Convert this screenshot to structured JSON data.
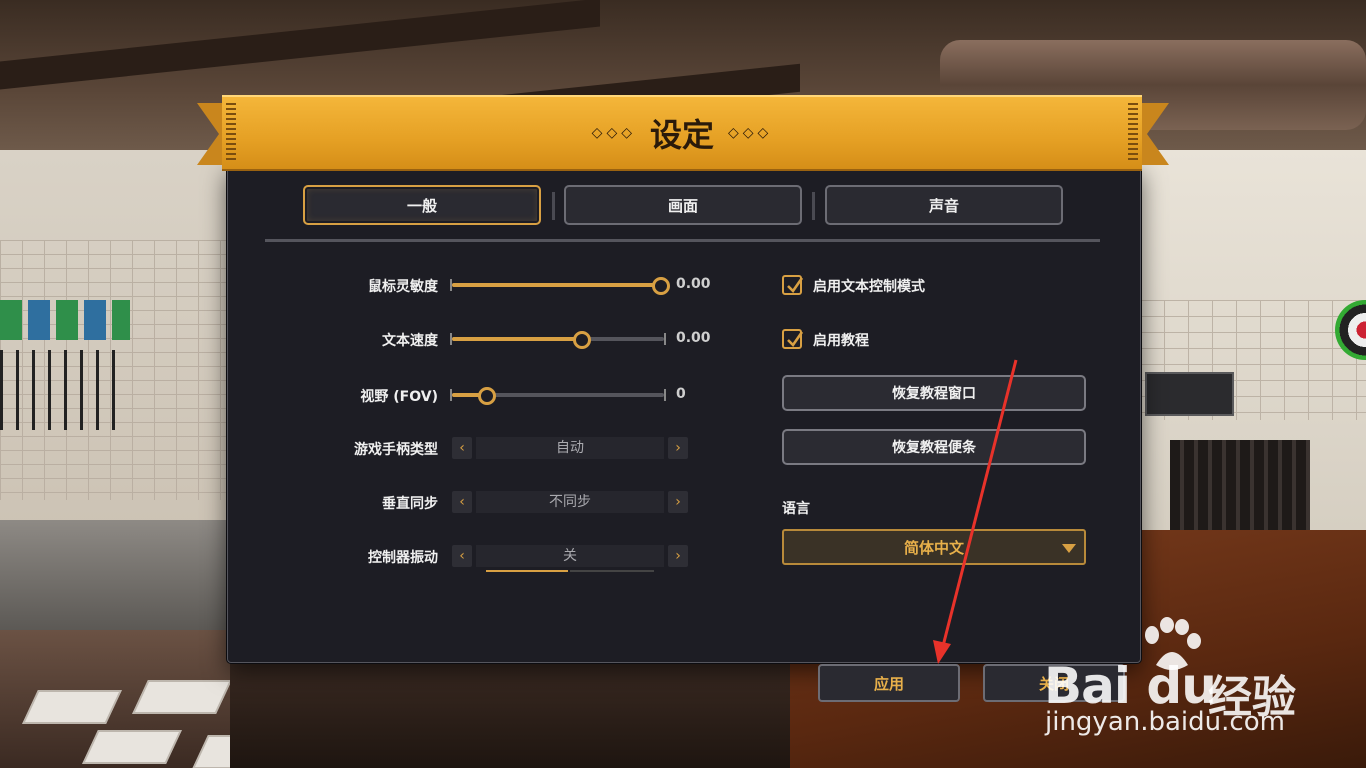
{
  "dialog": {
    "title": "设定",
    "title_deco_left": "◇◇◇",
    "title_deco_right": "◇◇◇"
  },
  "tabs": [
    {
      "label": "一般",
      "active": true
    },
    {
      "label": "画面",
      "active": false
    },
    {
      "label": "声音",
      "active": false
    }
  ],
  "settings": {
    "mouse_sensitivity": {
      "label": "鼠标灵敏度",
      "value": "0.00",
      "level": 1.0
    },
    "text_speed": {
      "label": "文本速度",
      "value": "0.00",
      "level": 0.6
    },
    "fov": {
      "label": "视野 (FOV)",
      "value": "0",
      "level": 0.15
    },
    "gamepad_type": {
      "label": "游戏手柄类型",
      "value": "自动"
    },
    "vsync": {
      "label": "垂直同步",
      "value": "不同步"
    },
    "controller_vibration": {
      "label": "控制器振动",
      "value": "关"
    }
  },
  "options": {
    "text_control_mode": {
      "label": "启用文本控制模式",
      "checked": true
    },
    "tutorial": {
      "label": "启用教程",
      "checked": true
    },
    "restore_tutorial_window": "恢复教程窗口",
    "restore_tutorial_notes": "恢复教程便条",
    "language_label": "语言",
    "language_value": "简体中文"
  },
  "footer": {
    "apply": "应用",
    "close": "关闭"
  },
  "watermark": {
    "brand": "Bai du",
    "brand_cn": "经验",
    "url": "jingyan.baidu.com"
  },
  "colors": {
    "accent": "#d8a043",
    "panel": "#1d1d24",
    "ribbon": "#e5a024",
    "annotation": "#e8322a"
  },
  "icons": [
    "chevron-left-icon",
    "chevron-right-icon",
    "checkmark-icon",
    "dropdown-caret-icon",
    "baidu-paw-icon"
  ]
}
